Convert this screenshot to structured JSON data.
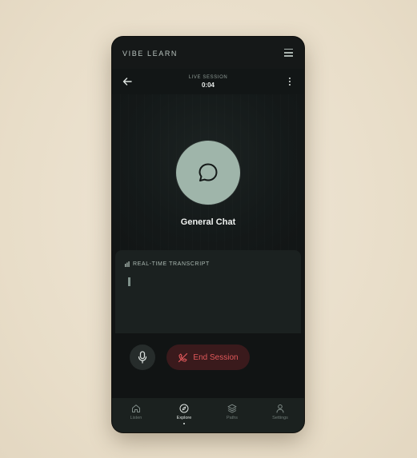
{
  "app": {
    "brand": "VIBE LEARN"
  },
  "session": {
    "label": "LIVE SESSION",
    "time": "0:04"
  },
  "topic": {
    "title": "General Chat",
    "icon": "chat-bubble-icon"
  },
  "transcript": {
    "heading": "REAL-TIME TRANSCRIPT"
  },
  "controls": {
    "end_label": "End Session"
  },
  "nav": {
    "items": [
      {
        "label": "Listen",
        "icon": "home-icon",
        "active": false
      },
      {
        "label": "Explore",
        "icon": "compass-icon",
        "active": true
      },
      {
        "label": "Paths",
        "icon": "layers-icon",
        "active": false
      },
      {
        "label": "Settings",
        "icon": "user-icon",
        "active": false
      }
    ]
  },
  "colors": {
    "accent": "#9fb5aa",
    "danger": "#e0585a",
    "background": "#121515"
  }
}
